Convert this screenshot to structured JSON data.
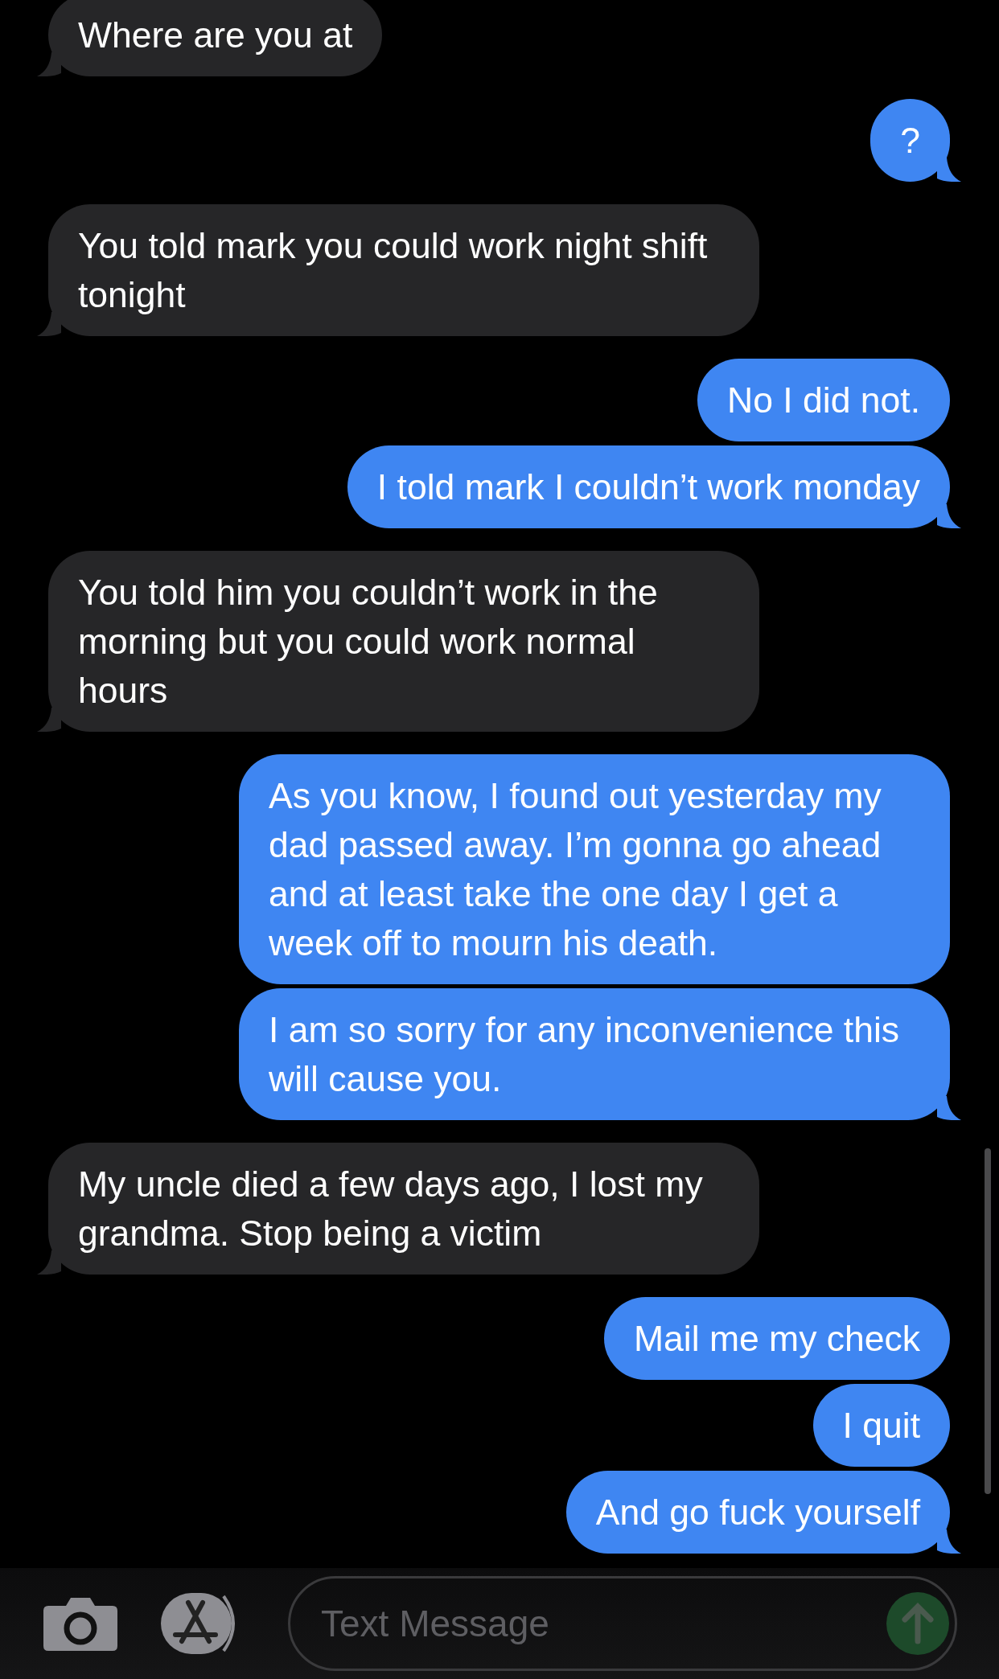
{
  "messages": [
    {
      "kind": "received",
      "text": "Where are you at",
      "tail": true
    },
    {
      "kind": "sent",
      "text": "?",
      "tail": true
    },
    {
      "kind": "received",
      "text": "You told mark you could work night shift tonight",
      "tail": true
    },
    {
      "kind": "sent",
      "text": "No I did not.",
      "tail": false
    },
    {
      "kind": "sent",
      "text": "I told mark I couldn’t work monday",
      "tail": true
    },
    {
      "kind": "received",
      "text": "You told him you couldn’t work in the morning but you could work normal hours",
      "tail": true
    },
    {
      "kind": "sent",
      "text": "As you know, I found out yesterday my dad passed away. I’m gonna go ahead and at least take the one day I get a week off to mourn his death.",
      "tail": false
    },
    {
      "kind": "sent",
      "text": "I am so sorry for any inconvenience this will cause you.",
      "tail": true
    },
    {
      "kind": "received",
      "text": "My uncle died a few days ago, I lost my grandma. Stop being a victim",
      "tail": true
    },
    {
      "kind": "sent",
      "text": "Mail me my check",
      "tail": false
    },
    {
      "kind": "sent",
      "text": "I quit",
      "tail": false
    },
    {
      "kind": "sent",
      "text": "And go fuck yourself",
      "tail": true
    }
  ],
  "composer": {
    "placeholder": "Text Message"
  }
}
